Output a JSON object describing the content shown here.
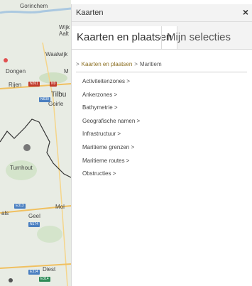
{
  "map": {
    "places": [
      {
        "name": "Gorinchem"
      },
      {
        "name": "Wijk"
      },
      {
        "name": "Aalt"
      },
      {
        "name": "Waalwijk"
      },
      {
        "name": "Dongen"
      },
      {
        "name": "M"
      },
      {
        "name": "Rijen"
      },
      {
        "name": "Tilbu"
      },
      {
        "name": "Goirle"
      },
      {
        "name": "Turnhout"
      },
      {
        "name": "Mol"
      },
      {
        "name": "Geel"
      },
      {
        "name": "als"
      },
      {
        "name": "Diest"
      }
    ],
    "roads": [
      "N261",
      "N9",
      "N630",
      "E313",
      "N174",
      "E314",
      "E314"
    ]
  },
  "panel": {
    "title": "Kaarten",
    "close": "×",
    "tabs": [
      {
        "label": "Kaarten en plaatsen"
      },
      {
        "label": "Mijn selecties"
      }
    ],
    "breadcrumb": {
      "arrow": ">",
      "link": "Kaarten en plaatsen",
      "separator": ">",
      "current": "Maritiem"
    },
    "items": [
      {
        "label": "Activiteitenzones >"
      },
      {
        "label": "Ankerzones >"
      },
      {
        "label": "Bathymetrie >"
      },
      {
        "label": "Geografische namen >"
      },
      {
        "label": "Infrastructuur >"
      },
      {
        "label": "Maritieme grenzen >"
      },
      {
        "label": "Maritieme routes >"
      },
      {
        "label": "Obstructies >"
      }
    ]
  }
}
